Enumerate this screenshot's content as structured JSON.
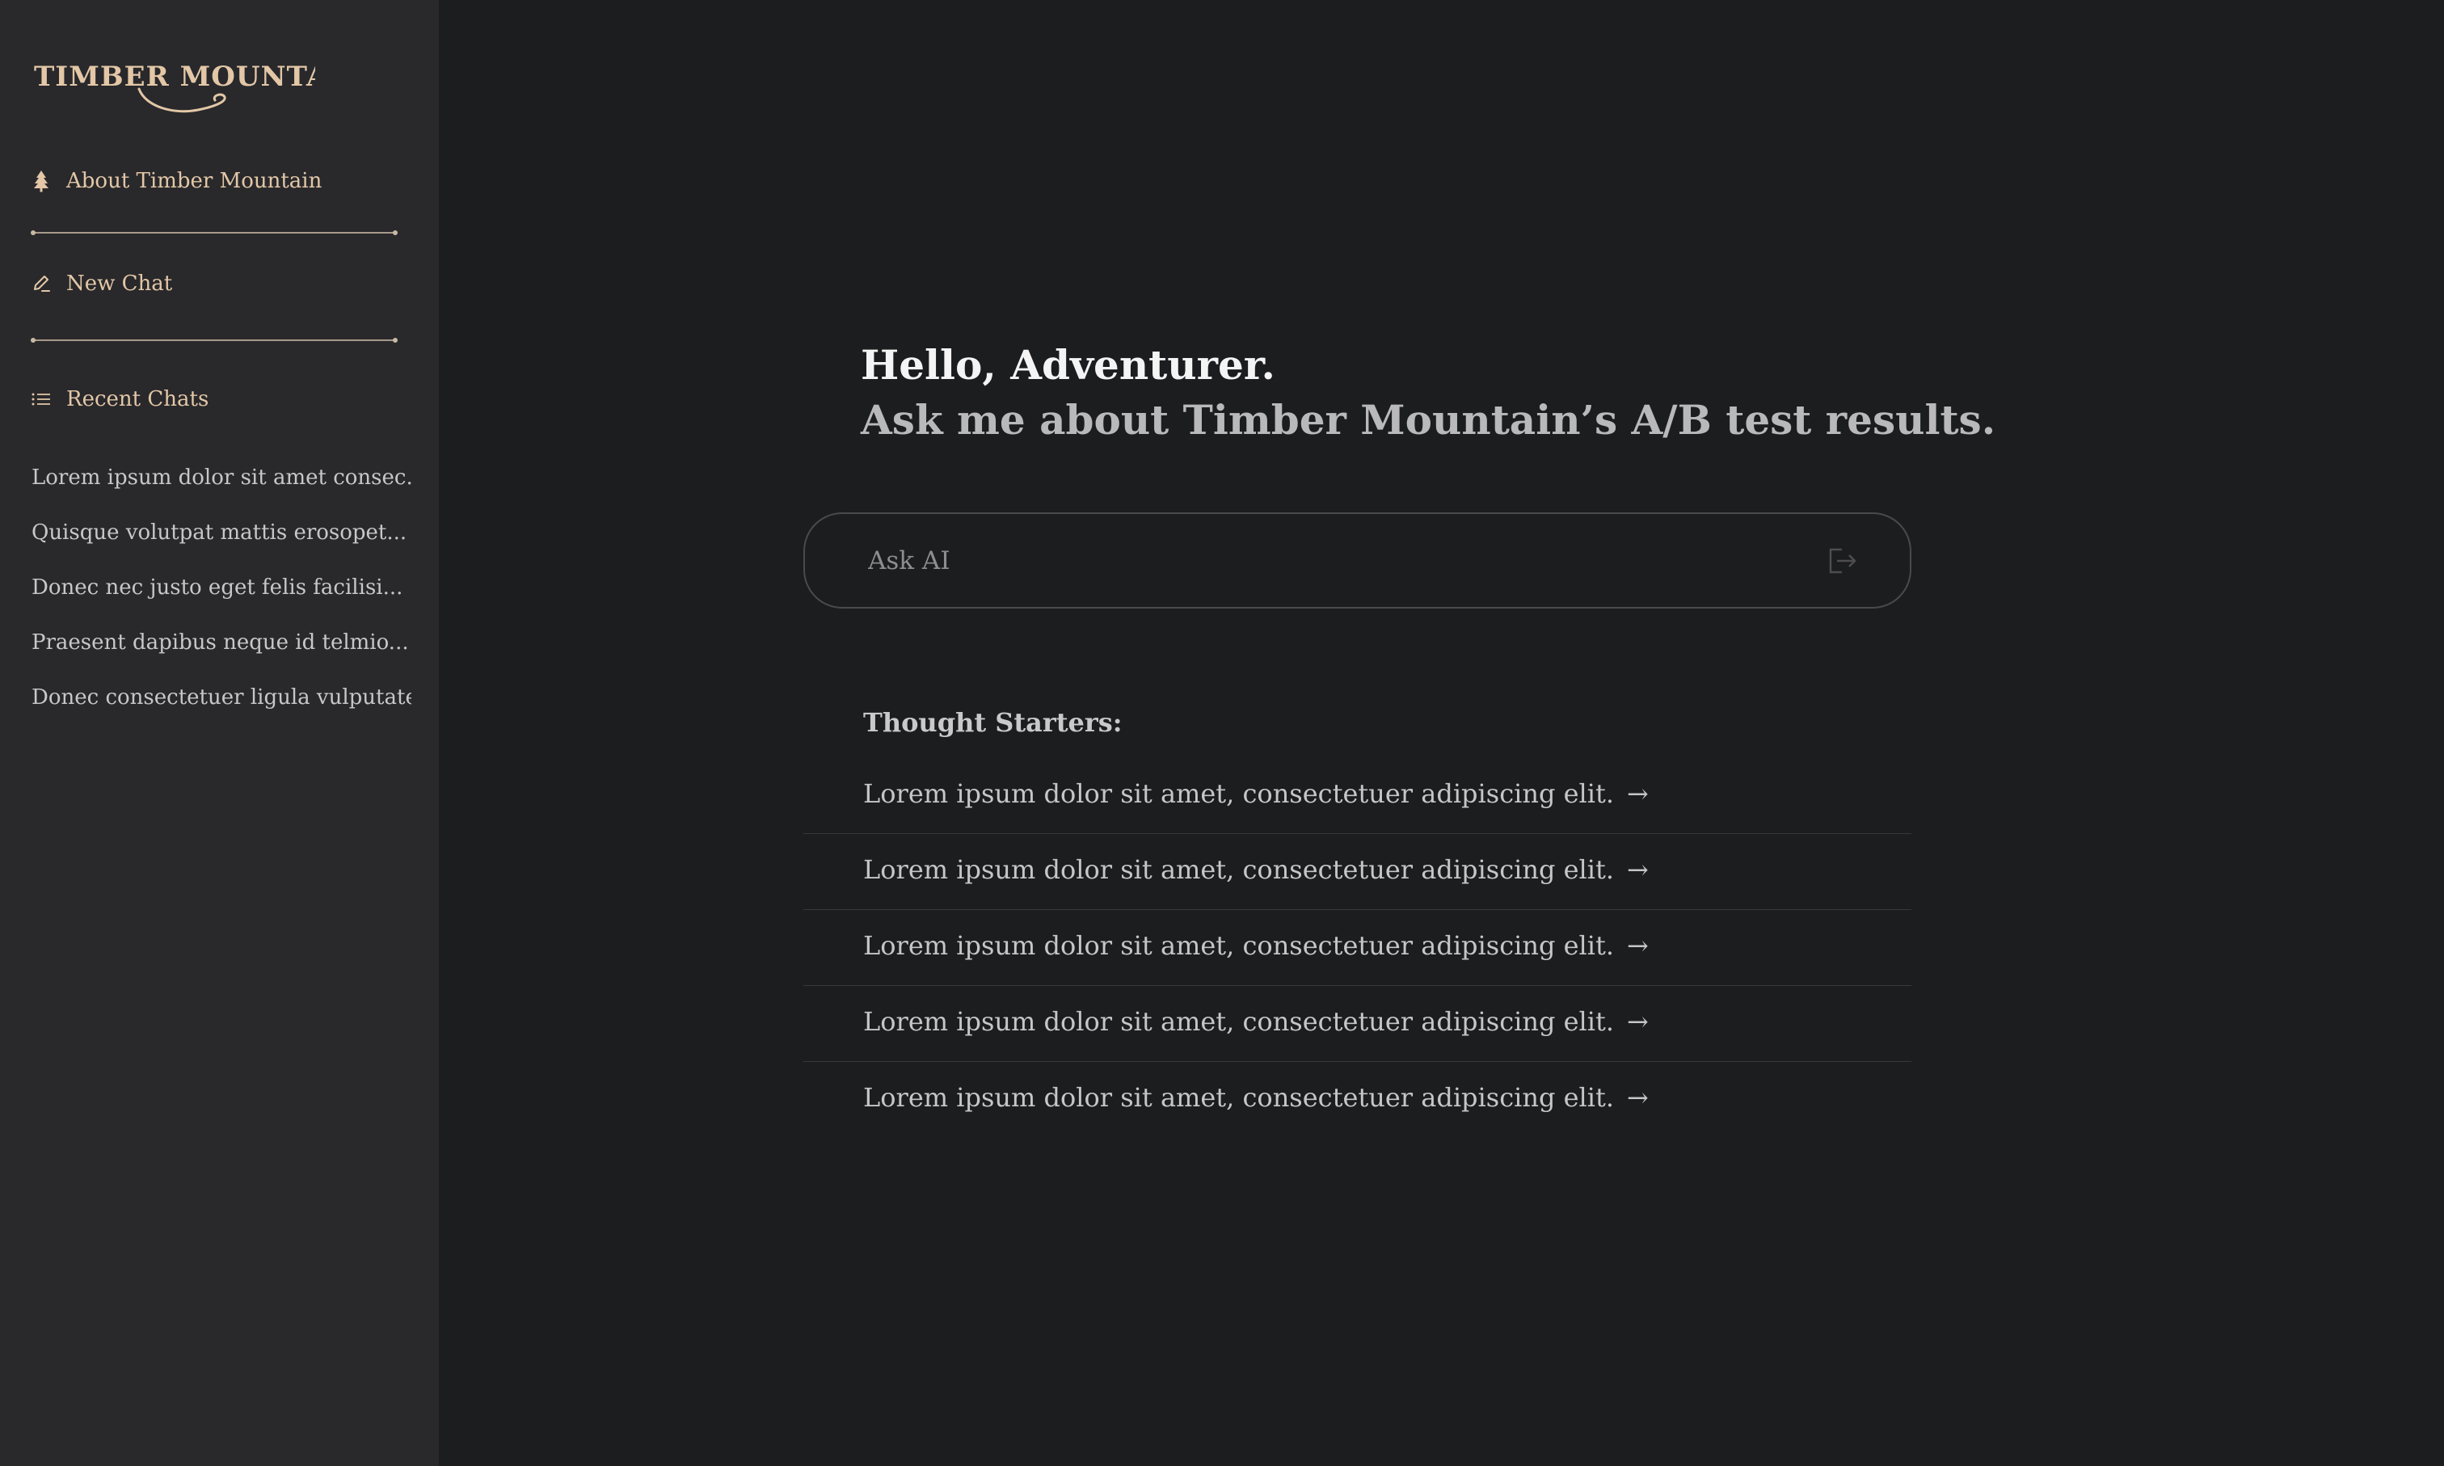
{
  "brand": {
    "logo_text": "TIMBER MOUNTAIN",
    "accent_color": "#e3c7a6"
  },
  "sidebar": {
    "about": {
      "label": "About Timber Mountain",
      "icon": "tree-icon"
    },
    "new_chat": {
      "label": "New Chat",
      "icon": "pencil-icon"
    },
    "recent": {
      "label": "Recent Chats",
      "icon": "list-icon"
    },
    "recent_items": [
      "Lorem ipsum dolor sit amet consec...",
      "Quisque volutpat mattis erosopet...",
      "Donec nec justo eget felis facilisi...",
      "Praesent dapibus neque id telmio...",
      "Donec consectetuer ligula vulputate..."
    ]
  },
  "main": {
    "greeting": "Hello, Adventurer.",
    "prompt": "Ask me about Timber Mountain’s A/B test results.",
    "search": {
      "placeholder": "Ask AI",
      "value": "",
      "send_icon": "send-arrow-icon"
    },
    "starters_title": "Thought Starters:",
    "starters": [
      "Lorem ipsum dolor sit amet, consectetuer adipiscing elit.",
      "Lorem ipsum dolor sit amet, consectetuer adipiscing elit.",
      "Lorem ipsum dolor sit amet, consectetuer adipiscing elit.",
      "Lorem ipsum dolor sit amet, consectetuer adipiscing elit.",
      "Lorem ipsum dolor sit amet, consectetuer adipiscing elit."
    ],
    "starter_arrow": "→"
  }
}
